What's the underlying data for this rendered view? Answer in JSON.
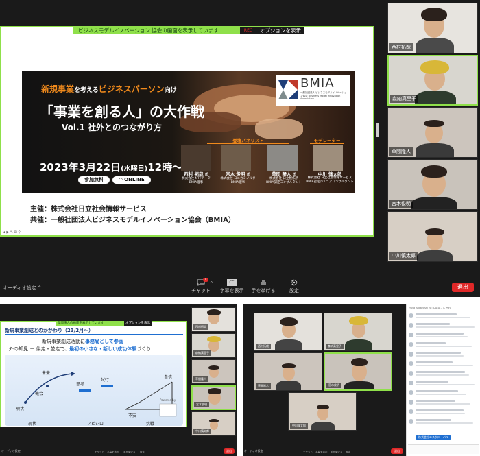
{
  "top": {
    "share_banner": "ビジネスモデルイノベーション 協会の画面を表示しています",
    "rec": "REC",
    "options_button": "オプションを表示",
    "slide": {
      "tagline_a": "新規事業",
      "tagline_b": "を考える",
      "tagline_c": "ビジネスパーソン",
      "tagline_d": "向け",
      "title": "「事業を創る人」の大作戦",
      "subtitle": "Vol.1 社外とのつながり方",
      "date": "2023年3月22日",
      "date_day": "(水曜日)",
      "date_time": "12時〜",
      "free_badge": "参加無料",
      "online_badge": "ONLINE",
      "logo_text": "BMIA",
      "logo_sub": "一般社団法人 ビジネスモデルイノベーション協会 Business Model Innovation Association",
      "panelists_label": "登壇パネリスト",
      "moderator_label": "モデレーター",
      "speakers": [
        {
          "name": "西村 拓哉",
          "honor": "氏",
          "org": "株式会社 NTTデータ",
          "role": "BMIA理事"
        },
        {
          "name": "宮木 俊明",
          "honor": "氏",
          "org": "株式会社 コニカミノルタ",
          "role": "BMIA理事"
        },
        {
          "name": "草間 隆人",
          "honor": "氏",
          "org": "株式会社 日立製作所",
          "role": "BMIA認定コンサルタント"
        },
        {
          "name": "中川 慎太郎",
          "honor": "",
          "org": "株式会社 日立社会情報サービス",
          "role": "BMIA認定ジュニアコンサルタント"
        }
      ],
      "host": "主催：株式会社日立社会情報サービス",
      "cohost": "共催：一般社団法人ビジネスモデルイノベーション協会（BMIA）"
    },
    "participants": [
      "西村拓哉",
      "森納真里子",
      "草間隆人",
      "宮木俊明",
      "中川慎太郎"
    ],
    "toolbar": {
      "audio_settings": "オーディオ設定",
      "chat": "チャット",
      "chat_badge": "1",
      "captions": "字幕を表示",
      "raise_hand": "手を挙げる",
      "settings": "設定",
      "leave": "退出"
    }
  },
  "bottom_left": {
    "share_banner": "草間隆人の画面を表示しています",
    "options_button": "オプションを表示",
    "slide": {
      "heading": "新規事業創成とのかかわり（23/2月〜）",
      "line1_a": "新規事業創成活動に",
      "line1_b": "事務局として参画",
      "line2_a": "外の知見 ＋ 伴走・並走で、",
      "line2_b": "最初の小さな・新しい成功体験",
      "line2_c": "づくり",
      "labels": [
        "現状",
        "機会",
        "未来",
        "思考",
        "試行",
        "自信",
        "不安",
        "Powered by"
      ],
      "footer": [
        "現状",
        "ノビシロ",
        "挑戦"
      ]
    },
    "participants": [
      "西村拓哉",
      "森納真里子",
      "草間隆人",
      "宮木俊明",
      "中川慎太郎"
    ],
    "toolbar": {
      "audio": "オーディオ設定",
      "items": [
        "チャット",
        "字幕を表示",
        "手を挙げる",
        "設定"
      ],
      "leave": "退出"
    }
  },
  "bottom_right": {
    "participants": [
      "西村拓哉",
      "森納真里子",
      "草間隆人",
      "宮木俊明",
      "中川慎太郎"
    ],
    "toolbar": {
      "audio": "オーディオ設定",
      "items": [
        "チャット",
        "字幕を表示",
        "手を挙げる",
        "設定"
      ],
      "leave": "退出"
    },
    "chat_header": "Yuya Kobayashi NTTDATA さん 西村",
    "chat_footer_tag": "株式会社エスグローバル"
  },
  "colors": {
    "accent_green": "#8fe04a",
    "leave_red": "#e02828",
    "slide_orange": "#f08a1c",
    "slide_blue": "#1f6fd1"
  }
}
